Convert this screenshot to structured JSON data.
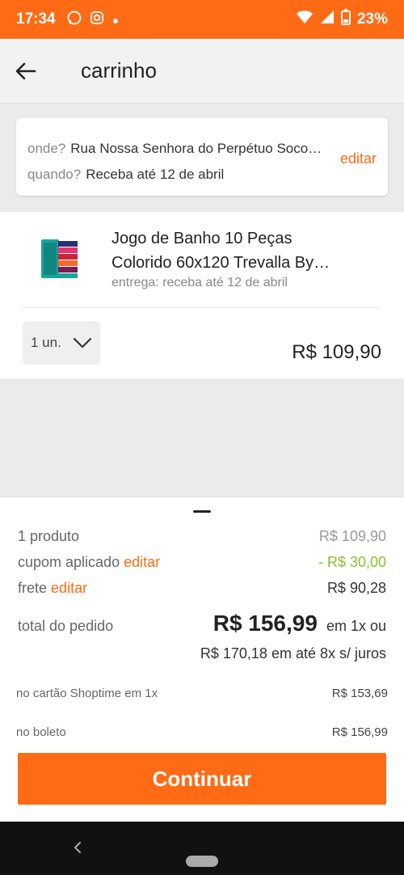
{
  "status_bar": {
    "time": "17:34",
    "battery": "23%",
    "icons": [
      "whatsapp-icon",
      "instagram-icon",
      "dot-icon",
      "wifi-icon",
      "signal-icon",
      "battery-icon"
    ]
  },
  "header": {
    "title": "carrinho"
  },
  "delivery": {
    "where_label": "onde?",
    "where_value": "Rua Nossa Senhora do Perpétuo Soco…",
    "when_label": "quando?",
    "when_value": "Receba até 12 de abril",
    "edit_label": "editar"
  },
  "product": {
    "name_line1": "Jogo de Banho 10 Peças",
    "name_line2": "Colorido 60x120 Trevalla By…",
    "shipping": "entrega: receba até 12 de abril",
    "quantity": "1 un.",
    "price": "R$ 109,90"
  },
  "summary": {
    "products_label": "1 produto",
    "products_value": "R$ 109,90",
    "coupon_label": "cupom aplicado",
    "coupon_edit": "editar",
    "coupon_value": "- R$ 30,00",
    "shipping_label": "frete",
    "shipping_edit": "editar",
    "shipping_value": "R$ 90,28",
    "total_label": "total do pedido",
    "total_value": "R$ 156,99",
    "total_suffix": "em 1x ou",
    "installments": "R$ 170,18 em até 8x s/ juros",
    "card_label": "no cartão Shoptime em 1x",
    "card_value": "R$ 153,69",
    "boleto_label": "no boleto",
    "boleto_value": "R$ 156,99",
    "continue_label": "Continuar"
  },
  "colors": {
    "accent": "#ff6b14",
    "discount": "#88c22a"
  }
}
